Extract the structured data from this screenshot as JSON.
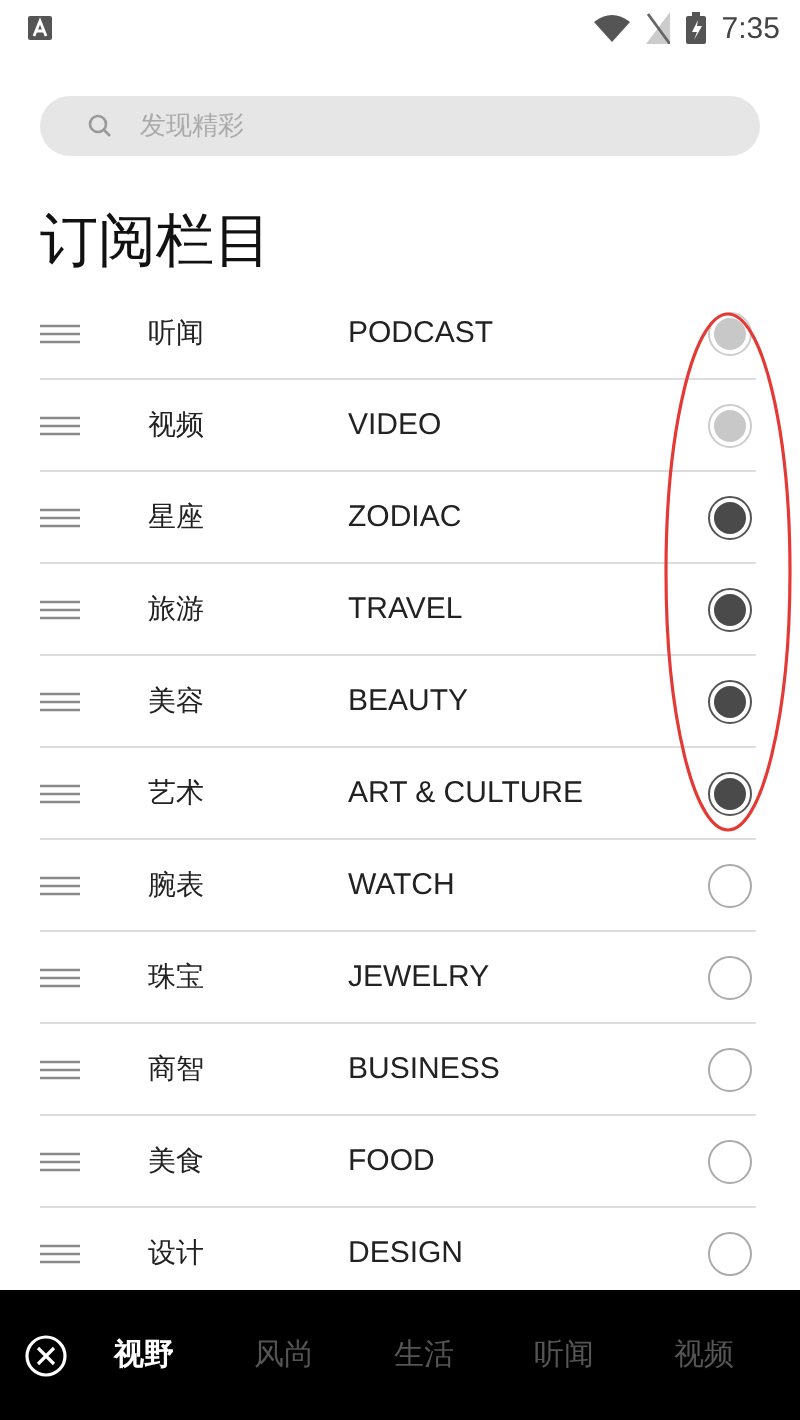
{
  "status_bar": {
    "time": "7:35"
  },
  "search": {
    "placeholder": "发现精彩"
  },
  "title": "订阅栏目",
  "channels": [
    {
      "name": "听闻",
      "english": "PODCAST",
      "checked": true,
      "disabled": true
    },
    {
      "name": "视频",
      "english": "VIDEO",
      "checked": true,
      "disabled": true
    },
    {
      "name": "星座",
      "english": "ZODIAC",
      "checked": true,
      "disabled": false
    },
    {
      "name": "旅游",
      "english": "TRAVEL",
      "checked": true,
      "disabled": false
    },
    {
      "name": "美容",
      "english": "BEAUTY",
      "checked": true,
      "disabled": false
    },
    {
      "name": "艺术",
      "english": "ART & CULTURE",
      "checked": true,
      "disabled": false
    },
    {
      "name": "腕表",
      "english": "WATCH",
      "checked": false,
      "disabled": false
    },
    {
      "name": "珠宝",
      "english": "JEWELRY",
      "checked": false,
      "disabled": false
    },
    {
      "name": "商智",
      "english": "BUSINESS",
      "checked": false,
      "disabled": false
    },
    {
      "name": "美食",
      "english": "FOOD",
      "checked": false,
      "disabled": false
    },
    {
      "name": "设计",
      "english": "DESIGN",
      "checked": false,
      "disabled": false
    }
  ],
  "annotation": {
    "kind": "ellipse"
  },
  "bottom_tabs": [
    {
      "label": "视野",
      "selected": true
    },
    {
      "label": "风尚",
      "selected": false
    },
    {
      "label": "生活",
      "selected": false
    },
    {
      "label": "听闻",
      "selected": false
    },
    {
      "label": "视频",
      "selected": false
    }
  ]
}
